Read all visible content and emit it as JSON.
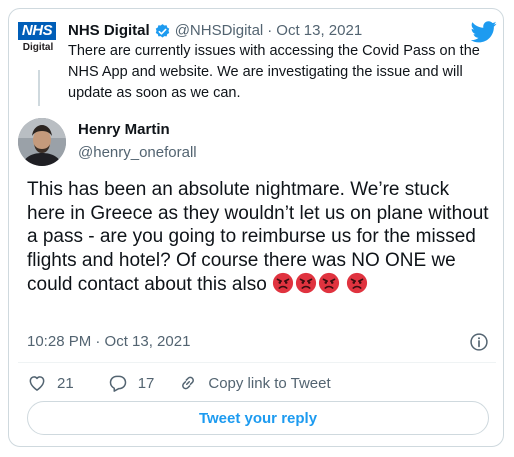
{
  "colors": {
    "accent": "#1d9bf0",
    "nhs_blue": "#005eb8",
    "muted_text": "#536471",
    "border": "#cfd9de",
    "angry_emoji": "#e0333f"
  },
  "icons": {
    "brand": "twitter-bird-icon",
    "verified": "verified-badge-icon",
    "info": "info-icon",
    "like": "heart-icon",
    "reply": "reply-bubble-icon",
    "share": "link-icon",
    "emoji": "angry-face-emoji"
  },
  "parent_tweet": {
    "logo_text": "NHS",
    "logo_subtext": "Digital",
    "name": "NHS Digital",
    "handle": "@NHSDigital",
    "separator": "·",
    "date": "Oct 13, 2021",
    "text": "There are currently issues with accessing the Covid Pass on the NHS App and website. We are investigating the issue and will update as soon as we can."
  },
  "tweet": {
    "author_name": "Henry Martin",
    "author_handle": "@henry_oneforall",
    "text_line_1": "This has been an absolute nightmare. We’re stuck here in Greece as they wouldn’t let us on plane without a pass - are you going to reimburse us for the missed flights and hotel? Of course there was NO ONE we could contact about this also",
    "emoji_count": 4,
    "timestamp": "10:28 PM · Oct 13, 2021"
  },
  "actions": {
    "like_count": "21",
    "reply_count": "17",
    "share_label": "Copy link to Tweet"
  },
  "reply_button_label": "Tweet your reply"
}
